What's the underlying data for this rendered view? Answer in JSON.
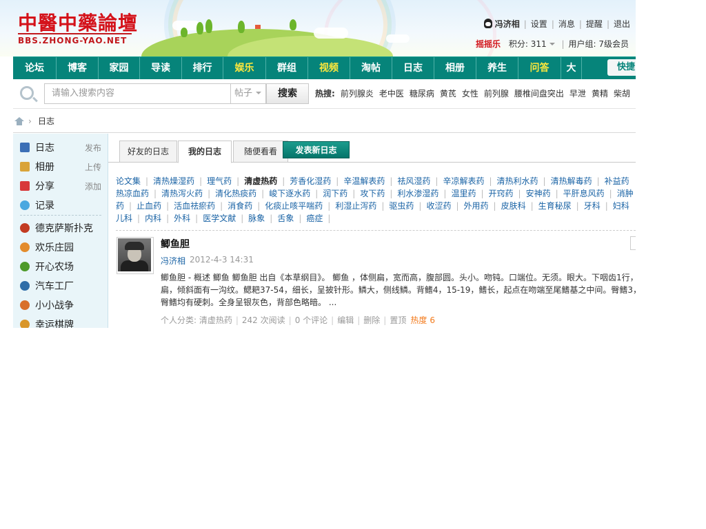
{
  "header": {
    "logo_text": "中醫中藥論壇",
    "logo_url": "BBS.ZHONG-YAO.NET",
    "user_name": "冯济相",
    "links": [
      "设置",
      "消息",
      "提醒",
      "退出"
    ],
    "shake_label": "摇摇乐",
    "points_label": "积分: 311",
    "user_group": "用户组: 7级会员"
  },
  "nav": {
    "items": [
      {
        "label": "论坛",
        "highlight": false
      },
      {
        "label": "博客",
        "highlight": false
      },
      {
        "label": "家园",
        "highlight": false
      },
      {
        "label": "导读",
        "highlight": false
      },
      {
        "label": "排行",
        "highlight": false
      },
      {
        "label": "娱乐",
        "highlight": true
      },
      {
        "label": "群组",
        "highlight": false
      },
      {
        "label": "视频",
        "highlight": true
      },
      {
        "label": "淘帖",
        "highlight": false
      },
      {
        "label": "日志",
        "highlight": false
      },
      {
        "label": "相册",
        "highlight": false
      },
      {
        "label": "养生",
        "highlight": false
      },
      {
        "label": "问答",
        "highlight": true
      },
      {
        "label": "大",
        "highlight": false
      }
    ],
    "quick_label": "快捷",
    "bg_color": "#06847a",
    "highlight_color": "#ffe83c"
  },
  "search": {
    "placeholder": "请输入搜索内容",
    "type_label": "帖子",
    "button_label": "搜索",
    "hot_label": "热搜:",
    "hot_items": [
      "前列腺炎",
      "老中医",
      "糖尿病",
      "黄芪",
      "女性",
      "前列腺",
      "腰椎间盘突出",
      "早泄",
      "黄精",
      "柴胡"
    ]
  },
  "breadcrumb": {
    "arrow": "›",
    "current": "日志"
  },
  "sidebar": {
    "primary": [
      {
        "label": "日志",
        "action": "发布",
        "icon": "blog-icon"
      },
      {
        "label": "相册",
        "action": "上传",
        "icon": "album-icon"
      },
      {
        "label": "分享",
        "action": "添加",
        "icon": "share-icon"
      },
      {
        "label": "记录",
        "action": "",
        "icon": "record-icon"
      }
    ],
    "apps": [
      {
        "label": "德克萨斯扑克",
        "icon": "poker-icon"
      },
      {
        "label": "欢乐庄园",
        "icon": "manor-icon"
      },
      {
        "label": "开心农场",
        "icon": "farm-icon"
      },
      {
        "label": "汽车工厂",
        "icon": "car-factory-icon"
      },
      {
        "label": "小小战争",
        "icon": "war-icon"
      },
      {
        "label": "幸运棋牌",
        "icon": "chess-icon"
      }
    ]
  },
  "main": {
    "tabs": [
      {
        "label": "好友的日志",
        "active": false
      },
      {
        "label": "我的日志",
        "active": true
      },
      {
        "label": "随便看看",
        "active": false
      }
    ],
    "post_button": "发表新日志",
    "categories": [
      [
        {
          "label": "论文集"
        },
        {
          "label": "清热燥湿药"
        },
        {
          "label": "理气药"
        },
        {
          "label": "清虚热药",
          "current": true
        },
        {
          "label": "芳香化湿药"
        },
        {
          "label": "辛温解表药"
        },
        {
          "label": "祛风湿药"
        },
        {
          "label": "辛凉解表药"
        },
        {
          "label": "清热利水药"
        },
        {
          "label": "清热解毒药"
        },
        {
          "label": "补益药"
        }
      ],
      [
        {
          "label": "热凉血药"
        },
        {
          "label": "清热泻火药"
        },
        {
          "label": "清化热痰药"
        },
        {
          "label": "峻下逐水药"
        },
        {
          "label": "润下药"
        },
        {
          "label": "攻下药"
        },
        {
          "label": "利水渗湿药"
        },
        {
          "label": "温里药"
        },
        {
          "label": "开窍药"
        },
        {
          "label": "安神药"
        },
        {
          "label": "平肝息风药"
        },
        {
          "label": "消肿"
        }
      ],
      [
        {
          "label": "药"
        },
        {
          "label": "止血药"
        },
        {
          "label": "活血祛瘀药"
        },
        {
          "label": "消食药"
        },
        {
          "label": "化痰止咳平喘药"
        },
        {
          "label": "利湿止泻药"
        },
        {
          "label": "驱虫药"
        },
        {
          "label": "收涩药"
        },
        {
          "label": "外用药"
        },
        {
          "label": "皮肤科"
        },
        {
          "label": "生育秘尿"
        },
        {
          "label": "牙科"
        },
        {
          "label": "妇科"
        }
      ],
      [
        {
          "label": "儿科"
        },
        {
          "label": "内科"
        },
        {
          "label": "外科"
        },
        {
          "label": "医学文献"
        },
        {
          "label": "脉象"
        },
        {
          "label": "舌象"
        },
        {
          "label": "癌症"
        }
      ]
    ],
    "entry": {
      "title": "鲫鱼胆",
      "author": "冯济相",
      "date": "2012-4-3 14:31",
      "body_lines": [
        "鲫鱼胆 - 概述 鲫鱼 鲫鱼胆 出自《本草纲目》。 鲫鱼 ，体侧扁，宽而高，腹部圆。头小。吻钝。口端位。无须。眼大。下咽齿1行，",
        "扁，倾斜面有一沟纹。鳃耙37-54，细长，呈披针形。鳞大，侧线鳞。背鳍4，15-19，鳍长，起点在吻端至尾鳍基之中间。臀鳍3，",
        "臀鳍均有硬刺。全身呈银灰色，背部色略暗。 ..."
      ],
      "category_label": "个人分类: 清虚热药",
      "reads": "242 次阅读",
      "comments": "0 个评论",
      "edit_label": "编辑",
      "delete_label": "删除",
      "pin_label": "置顶",
      "heat_label": "热度",
      "heat_value": "6"
    }
  }
}
